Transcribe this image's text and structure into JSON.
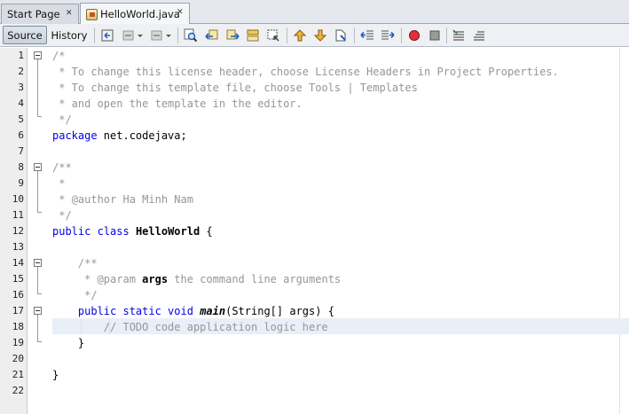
{
  "tabs": [
    {
      "label": "Start Page",
      "active": false
    },
    {
      "label": "HelloWorld.java",
      "active": true
    }
  ],
  "toolbar": {
    "source_label": "Source",
    "history_label": "History",
    "icons": [
      "last-edit-icon",
      "back-icon",
      "forward-icon",
      "find-icon",
      "find-previous-icon",
      "find-next-icon",
      "toggle-highlight-icon",
      "find-selection-icon",
      "previous-bookmark-icon",
      "next-bookmark-icon",
      "toggle-bookmark-icon",
      "shift-left-icon",
      "shift-right-icon",
      "start-macro-icon",
      "stop-macro-icon",
      "comment-icon",
      "uncomment-icon"
    ]
  },
  "colors": {
    "keyword": "#0000e6",
    "comment": "#969696",
    "current_line": "#e9eff8"
  },
  "editor": {
    "line_numbers": [
      "1",
      "2",
      "3",
      "4",
      "5",
      "6",
      "7",
      "8",
      "9",
      "10",
      "11",
      "12",
      "13",
      "14",
      "15",
      "16",
      "17",
      "18",
      "19",
      "20",
      "21",
      "22"
    ],
    "lines": [
      {
        "t": "/*"
      },
      {
        "t": " * To change this license header, choose License Headers in Project Properties."
      },
      {
        "t": " * To change this template file, choose Tools | Templates"
      },
      {
        "t": " * and open the template in the editor."
      },
      {
        "t": " */"
      },
      {
        "kw1": "package",
        "rest": " net.codejava;"
      },
      {
        "t": ""
      },
      {
        "t": "/**"
      },
      {
        "t": " *"
      },
      {
        "pre": " * ",
        "tag": "@author",
        "post": " Ha Minh Nam"
      },
      {
        "t": " */"
      },
      {
        "kw1": "public",
        "mid": " ",
        "kw2": "class",
        "sp": " ",
        "name": "HelloWorld",
        "rest": " {"
      },
      {
        "t": ""
      },
      {
        "t": "    /**"
      },
      {
        "pre": "     * ",
        "tag": "@param",
        "sp": " ",
        "arg": "args",
        "post": " the command line arguments"
      },
      {
        "t": "     */"
      },
      {
        "ind": "    ",
        "kw1": "public static void",
        "sp": " ",
        "method": "main",
        "rest": "(String[] args) {"
      },
      {
        "t": "        // TODO code application logic here"
      },
      {
        "t": "    }"
      },
      {
        "t": ""
      },
      {
        "t": "}"
      },
      {
        "t": ""
      }
    ]
  }
}
